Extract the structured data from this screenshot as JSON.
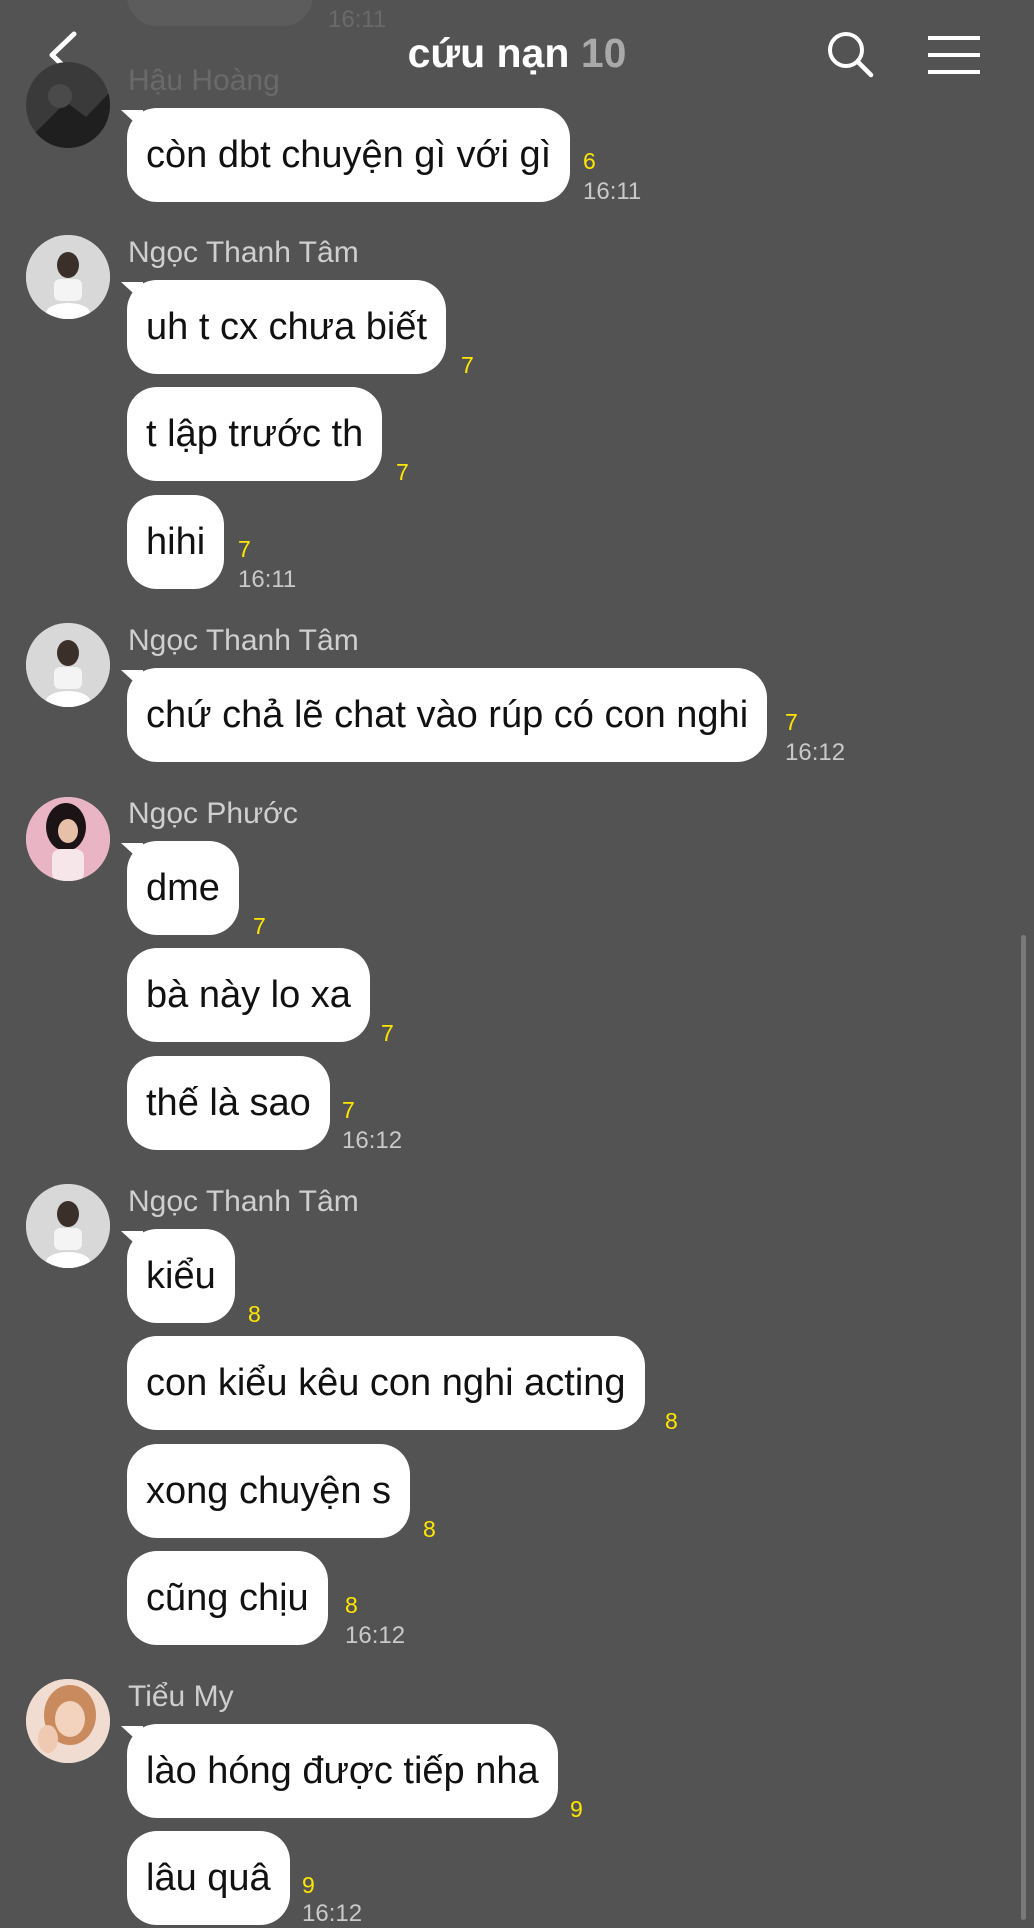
{
  "header": {
    "title": "cứu nạn",
    "member_count": "10",
    "back_icon": "chevron-left-icon",
    "search_icon": "search-icon",
    "menu_icon": "hamburger-menu-icon"
  },
  "colors": {
    "background": "#545354",
    "bubble": "#ffffff",
    "read_count": "#ffe600",
    "timestamp": "#c9c9c9"
  },
  "top_fragment": {
    "time": "16:11"
  },
  "groups": [
    {
      "sender": "Hậu Hoàng",
      "messages": [
        {
          "text": "còn dbt chuyện gì với gì",
          "read": "6",
          "time": "16:11"
        }
      ]
    },
    {
      "sender": "Ngọc Thanh Tâm",
      "messages": [
        {
          "text": "uh t cx chưa biết",
          "read": "7"
        },
        {
          "text": "t lập trước th",
          "read": "7"
        },
        {
          "text": "hihi",
          "read": "7",
          "time": "16:11"
        }
      ]
    },
    {
      "sender": "Ngọc Thanh Tâm",
      "messages": [
        {
          "text": "chứ chả lẽ chat vào rúp có con nghi",
          "read": "7",
          "time": "16:12"
        }
      ]
    },
    {
      "sender": "Ngọc Phước",
      "messages": [
        {
          "text": "dme",
          "read": "7"
        },
        {
          "text": "bà này lo xa",
          "read": "7"
        },
        {
          "text": "thế là sao",
          "read": "7",
          "time": "16:12"
        }
      ]
    },
    {
      "sender": "Ngọc Thanh Tâm",
      "messages": [
        {
          "text": "kiểu",
          "read": "8"
        },
        {
          "text": "con kiểu kêu con nghi acting",
          "read": "8"
        },
        {
          "text": "xong chuyện s",
          "read": "8"
        },
        {
          "text": "cũng chịu",
          "read": "8",
          "time": "16:12"
        }
      ]
    },
    {
      "sender": "Tiểu My",
      "messages": [
        {
          "text": "lào hóng được tiếp nha",
          "read": "9"
        },
        {
          "text": "lâu quâ",
          "read": "9",
          "time": "16:12"
        }
      ]
    }
  ]
}
